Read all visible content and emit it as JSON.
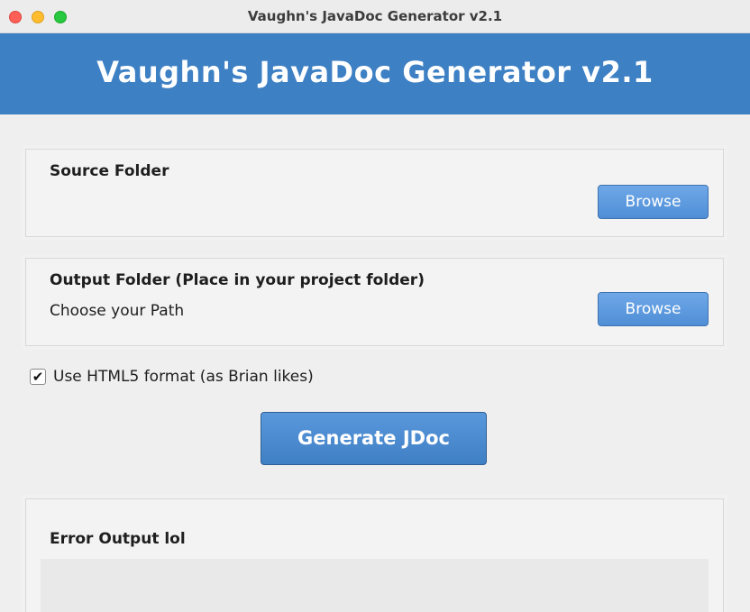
{
  "window": {
    "title": "Vaughn's JavaDoc Generator v2.1"
  },
  "banner": {
    "title": "Vaughn's JavaDoc Generator v2.1"
  },
  "source_panel": {
    "label": "Source Folder",
    "browse_label": "Browse"
  },
  "output_panel": {
    "label": "Output Folder (Place in your project folder)",
    "path_text": "Choose your Path",
    "browse_label": "Browse"
  },
  "html5_option": {
    "label": "Use HTML5 format (as Brian likes)",
    "checked": true,
    "check_glyph": "✔"
  },
  "generate_button": {
    "label": "Generate JDoc"
  },
  "error_panel": {
    "label": "Error Output lol"
  },
  "colors": {
    "banner": "#3d80c4",
    "button": "#4f8ed6"
  }
}
